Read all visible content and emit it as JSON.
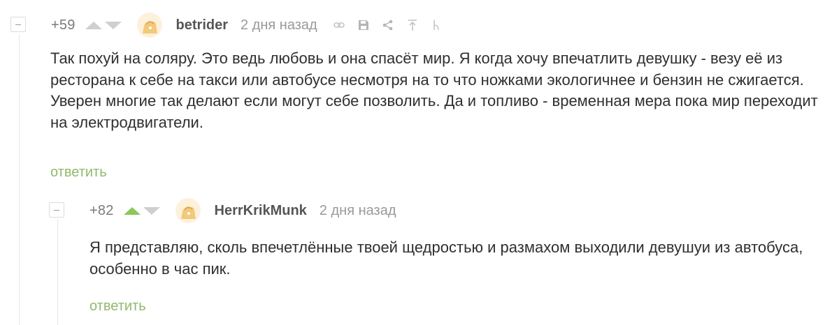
{
  "comments": [
    {
      "rating": "+59",
      "author": "betrider",
      "time": "2 дня назад",
      "text": "Так похуй на соляру. Это ведь любовь и она спасёт мир. Я когда хочу впечатлить девушку - везу её из ресторана к себе на такси или автобусе несмотря на то что ножками экологичнее и бензин не сжигается. Уверен многие так делают если могут себе позволить. Да и топливо - временная мера пока мир переходит на электродвигатели.",
      "reply_label": "ответить",
      "upvoted": false
    },
    {
      "rating": "+82",
      "author": "HerrKrikMunk",
      "time": "2 дня назад",
      "text": "Я представляю, сколь впечетлённые твоей щедростью и размахом выходили девушуи из автобуса, особенно в час пик.",
      "reply_label": "ответить",
      "upvoted": true
    }
  ],
  "colors": {
    "upvote_active": "#8ac858",
    "reply_link": "#8fba6b",
    "meta_text": "#999999"
  },
  "icons": [
    "collapse-icon",
    "upvote-icon",
    "downvote-icon",
    "avatar",
    "link-icon",
    "save-icon",
    "share-icon",
    "go-to-parent-icon",
    "branch-icon"
  ]
}
